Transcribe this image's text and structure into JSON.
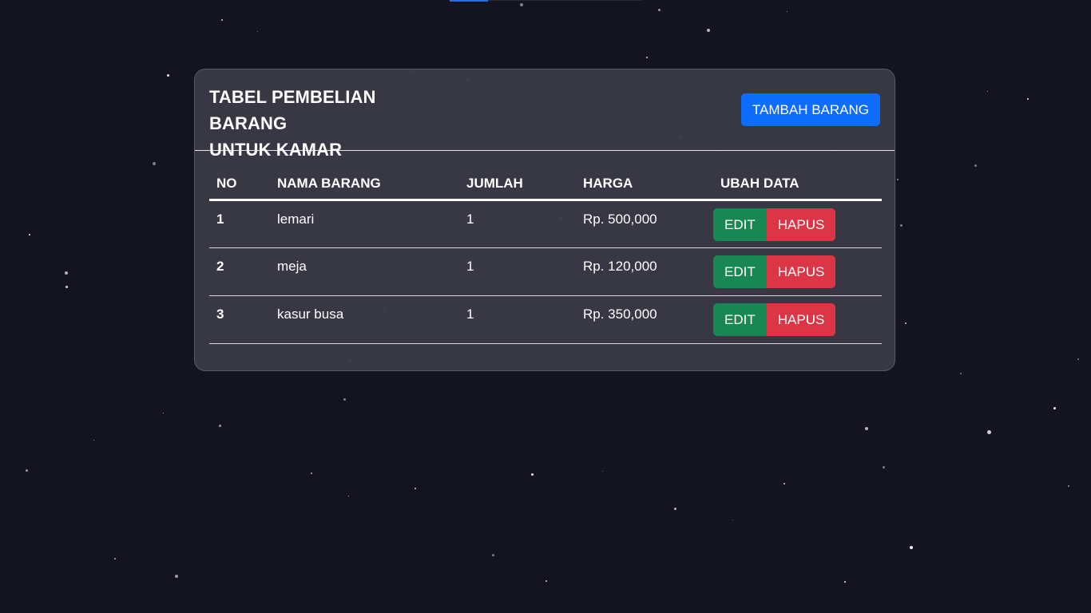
{
  "card": {
    "title_line1": "TABEL PEMBELIAN BARANG",
    "title_line2": "UNTUK KAMAR",
    "add_button_label": "TAMBAH BARANG"
  },
  "table": {
    "headers": [
      "NO",
      "NAMA BARANG",
      "JUMLAH",
      "HARGA",
      "UBAH DATA"
    ],
    "rows": [
      {
        "no": "1",
        "name": "lemari",
        "qty": "1",
        "price": "Rp. 500,000"
      },
      {
        "no": "2",
        "name": "meja",
        "qty": "1",
        "price": "Rp. 120,000"
      },
      {
        "no": "3",
        "name": "kasur busa",
        "qty": "1",
        "price": "Rp. 350,000"
      }
    ],
    "edit_label": "EDIT",
    "delete_label": "HAPUS"
  },
  "colors": {
    "background": "#141421",
    "card": "#3a3a46",
    "primary": "#0d6efd",
    "success": "#198754",
    "danger": "#dc3545"
  }
}
